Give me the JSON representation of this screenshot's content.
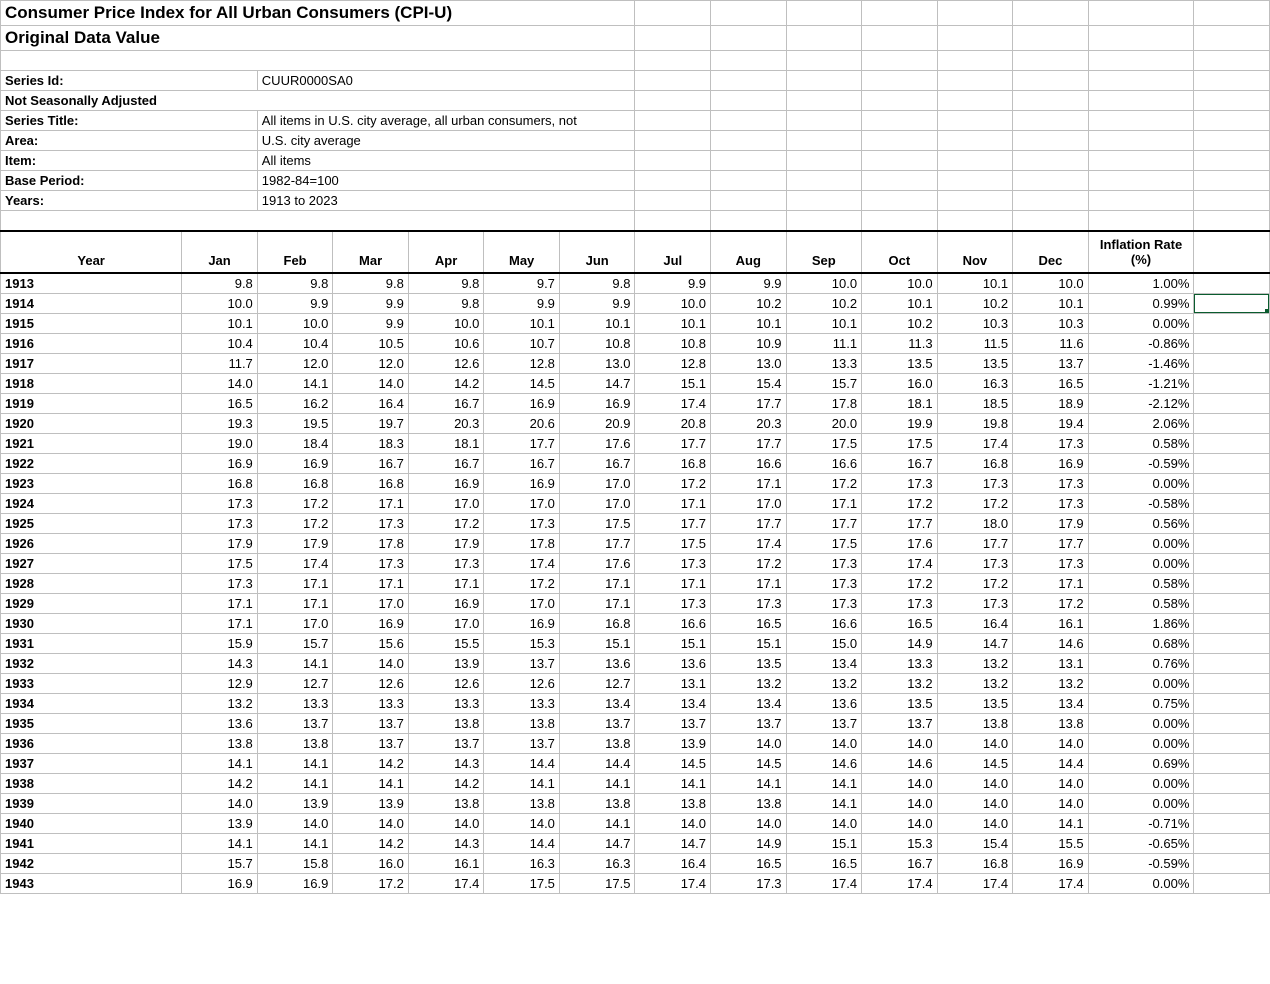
{
  "title": "Consumer Price Index for All Urban Consumers (CPI-U)",
  "subtitle": "Original Data Value",
  "meta": {
    "series_id_label": "Series Id:",
    "series_id": "CUUR0000SA0",
    "seasonal": "Not Seasonally Adjusted",
    "series_title_label": "Series Title:",
    "series_title": "All items in U.S. city average, all urban consumers, not",
    "area_label": "Area:",
    "area": "U.S. city average",
    "item_label": "Item:",
    "item": "All items",
    "base_label": "Base Period:",
    "base": "1982-84=100",
    "years_label": "Years:",
    "years": "1913 to 2023"
  },
  "headers": {
    "year": "Year",
    "months": [
      "Jan",
      "Feb",
      "Mar",
      "Apr",
      "May",
      "Jun",
      "Jul",
      "Aug",
      "Sep",
      "Oct",
      "Nov",
      "Dec"
    ],
    "rate": "Inflation Rate (%)"
  },
  "rows": [
    {
      "year": "1913",
      "m": [
        "9.8",
        "9.8",
        "9.8",
        "9.8",
        "9.7",
        "9.8",
        "9.9",
        "9.9",
        "10.0",
        "10.0",
        "10.1",
        "10.0"
      ],
      "rate": "1.00%"
    },
    {
      "year": "1914",
      "m": [
        "10.0",
        "9.9",
        "9.9",
        "9.8",
        "9.9",
        "9.9",
        "10.0",
        "10.2",
        "10.2",
        "10.1",
        "10.2",
        "10.1"
      ],
      "rate": "0.99%"
    },
    {
      "year": "1915",
      "m": [
        "10.1",
        "10.0",
        "9.9",
        "10.0",
        "10.1",
        "10.1",
        "10.1",
        "10.1",
        "10.1",
        "10.2",
        "10.3",
        "10.3"
      ],
      "rate": "0.00%"
    },
    {
      "year": "1916",
      "m": [
        "10.4",
        "10.4",
        "10.5",
        "10.6",
        "10.7",
        "10.8",
        "10.8",
        "10.9",
        "11.1",
        "11.3",
        "11.5",
        "11.6"
      ],
      "rate": "-0.86%"
    },
    {
      "year": "1917",
      "m": [
        "11.7",
        "12.0",
        "12.0",
        "12.6",
        "12.8",
        "13.0",
        "12.8",
        "13.0",
        "13.3",
        "13.5",
        "13.5",
        "13.7"
      ],
      "rate": "-1.46%"
    },
    {
      "year": "1918",
      "m": [
        "14.0",
        "14.1",
        "14.0",
        "14.2",
        "14.5",
        "14.7",
        "15.1",
        "15.4",
        "15.7",
        "16.0",
        "16.3",
        "16.5"
      ],
      "rate": "-1.21%"
    },
    {
      "year": "1919",
      "m": [
        "16.5",
        "16.2",
        "16.4",
        "16.7",
        "16.9",
        "16.9",
        "17.4",
        "17.7",
        "17.8",
        "18.1",
        "18.5",
        "18.9"
      ],
      "rate": "-2.12%"
    },
    {
      "year": "1920",
      "m": [
        "19.3",
        "19.5",
        "19.7",
        "20.3",
        "20.6",
        "20.9",
        "20.8",
        "20.3",
        "20.0",
        "19.9",
        "19.8",
        "19.4"
      ],
      "rate": "2.06%"
    },
    {
      "year": "1921",
      "m": [
        "19.0",
        "18.4",
        "18.3",
        "18.1",
        "17.7",
        "17.6",
        "17.7",
        "17.7",
        "17.5",
        "17.5",
        "17.4",
        "17.3"
      ],
      "rate": "0.58%"
    },
    {
      "year": "1922",
      "m": [
        "16.9",
        "16.9",
        "16.7",
        "16.7",
        "16.7",
        "16.7",
        "16.8",
        "16.6",
        "16.6",
        "16.7",
        "16.8",
        "16.9"
      ],
      "rate": "-0.59%"
    },
    {
      "year": "1923",
      "m": [
        "16.8",
        "16.8",
        "16.8",
        "16.9",
        "16.9",
        "17.0",
        "17.2",
        "17.1",
        "17.2",
        "17.3",
        "17.3",
        "17.3"
      ],
      "rate": "0.00%"
    },
    {
      "year": "1924",
      "m": [
        "17.3",
        "17.2",
        "17.1",
        "17.0",
        "17.0",
        "17.0",
        "17.1",
        "17.0",
        "17.1",
        "17.2",
        "17.2",
        "17.3"
      ],
      "rate": "-0.58%"
    },
    {
      "year": "1925",
      "m": [
        "17.3",
        "17.2",
        "17.3",
        "17.2",
        "17.3",
        "17.5",
        "17.7",
        "17.7",
        "17.7",
        "17.7",
        "18.0",
        "17.9"
      ],
      "rate": "0.56%"
    },
    {
      "year": "1926",
      "m": [
        "17.9",
        "17.9",
        "17.8",
        "17.9",
        "17.8",
        "17.7",
        "17.5",
        "17.4",
        "17.5",
        "17.6",
        "17.7",
        "17.7"
      ],
      "rate": "0.00%"
    },
    {
      "year": "1927",
      "m": [
        "17.5",
        "17.4",
        "17.3",
        "17.3",
        "17.4",
        "17.6",
        "17.3",
        "17.2",
        "17.3",
        "17.4",
        "17.3",
        "17.3"
      ],
      "rate": "0.00%"
    },
    {
      "year": "1928",
      "m": [
        "17.3",
        "17.1",
        "17.1",
        "17.1",
        "17.2",
        "17.1",
        "17.1",
        "17.1",
        "17.3",
        "17.2",
        "17.2",
        "17.1"
      ],
      "rate": "0.58%"
    },
    {
      "year": "1929",
      "m": [
        "17.1",
        "17.1",
        "17.0",
        "16.9",
        "17.0",
        "17.1",
        "17.3",
        "17.3",
        "17.3",
        "17.3",
        "17.3",
        "17.2"
      ],
      "rate": "0.58%"
    },
    {
      "year": "1930",
      "m": [
        "17.1",
        "17.0",
        "16.9",
        "17.0",
        "16.9",
        "16.8",
        "16.6",
        "16.5",
        "16.6",
        "16.5",
        "16.4",
        "16.1"
      ],
      "rate": "1.86%"
    },
    {
      "year": "1931",
      "m": [
        "15.9",
        "15.7",
        "15.6",
        "15.5",
        "15.3",
        "15.1",
        "15.1",
        "15.1",
        "15.0",
        "14.9",
        "14.7",
        "14.6"
      ],
      "rate": "0.68%"
    },
    {
      "year": "1932",
      "m": [
        "14.3",
        "14.1",
        "14.0",
        "13.9",
        "13.7",
        "13.6",
        "13.6",
        "13.5",
        "13.4",
        "13.3",
        "13.2",
        "13.1"
      ],
      "rate": "0.76%"
    },
    {
      "year": "1933",
      "m": [
        "12.9",
        "12.7",
        "12.6",
        "12.6",
        "12.6",
        "12.7",
        "13.1",
        "13.2",
        "13.2",
        "13.2",
        "13.2",
        "13.2"
      ],
      "rate": "0.00%"
    },
    {
      "year": "1934",
      "m": [
        "13.2",
        "13.3",
        "13.3",
        "13.3",
        "13.3",
        "13.4",
        "13.4",
        "13.4",
        "13.6",
        "13.5",
        "13.5",
        "13.4"
      ],
      "rate": "0.75%"
    },
    {
      "year": "1935",
      "m": [
        "13.6",
        "13.7",
        "13.7",
        "13.8",
        "13.8",
        "13.7",
        "13.7",
        "13.7",
        "13.7",
        "13.7",
        "13.8",
        "13.8"
      ],
      "rate": "0.00%"
    },
    {
      "year": "1936",
      "m": [
        "13.8",
        "13.8",
        "13.7",
        "13.7",
        "13.7",
        "13.8",
        "13.9",
        "14.0",
        "14.0",
        "14.0",
        "14.0",
        "14.0"
      ],
      "rate": "0.00%"
    },
    {
      "year": "1937",
      "m": [
        "14.1",
        "14.1",
        "14.2",
        "14.3",
        "14.4",
        "14.4",
        "14.5",
        "14.5",
        "14.6",
        "14.6",
        "14.5",
        "14.4"
      ],
      "rate": "0.69%"
    },
    {
      "year": "1938",
      "m": [
        "14.2",
        "14.1",
        "14.1",
        "14.2",
        "14.1",
        "14.1",
        "14.1",
        "14.1",
        "14.1",
        "14.0",
        "14.0",
        "14.0"
      ],
      "rate": "0.00%"
    },
    {
      "year": "1939",
      "m": [
        "14.0",
        "13.9",
        "13.9",
        "13.8",
        "13.8",
        "13.8",
        "13.8",
        "13.8",
        "14.1",
        "14.0",
        "14.0",
        "14.0"
      ],
      "rate": "0.00%"
    },
    {
      "year": "1940",
      "m": [
        "13.9",
        "14.0",
        "14.0",
        "14.0",
        "14.0",
        "14.1",
        "14.0",
        "14.0",
        "14.0",
        "14.0",
        "14.0",
        "14.1"
      ],
      "rate": "-0.71%"
    },
    {
      "year": "1941",
      "m": [
        "14.1",
        "14.1",
        "14.2",
        "14.3",
        "14.4",
        "14.7",
        "14.7",
        "14.9",
        "15.1",
        "15.3",
        "15.4",
        "15.5"
      ],
      "rate": "-0.65%"
    },
    {
      "year": "1942",
      "m": [
        "15.7",
        "15.8",
        "16.0",
        "16.1",
        "16.3",
        "16.3",
        "16.4",
        "16.5",
        "16.5",
        "16.7",
        "16.8",
        "16.9"
      ],
      "rate": "-0.59%"
    },
    {
      "year": "1943",
      "m": [
        "16.9",
        "16.9",
        "17.2",
        "17.4",
        "17.5",
        "17.5",
        "17.4",
        "17.3",
        "17.4",
        "17.4",
        "17.4",
        "17.4"
      ],
      "rate": "0.00%"
    }
  ]
}
